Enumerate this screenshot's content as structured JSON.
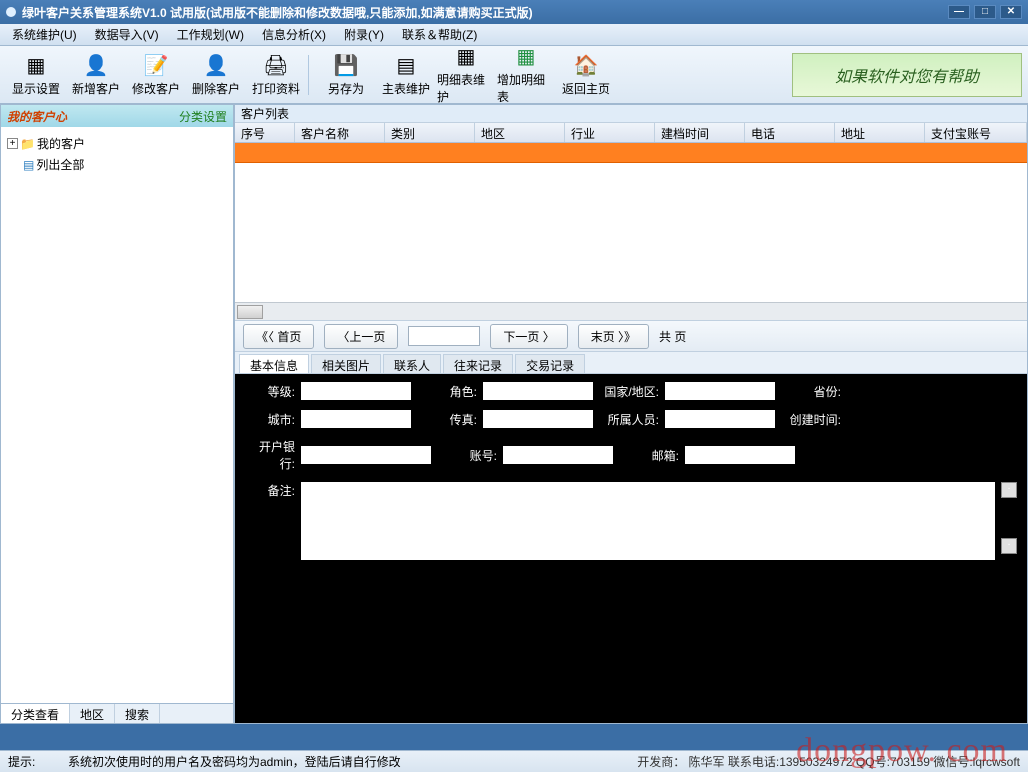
{
  "window": {
    "title": "绿叶客户关系管理系统V1.0 试用版(试用版不能删除和修改数据哦,只能添加,如满意请购买正式版)"
  },
  "menu": [
    "系统维护(U)",
    "数据导入(V)",
    "工作规划(W)",
    "信息分析(X)",
    "附录(Y)",
    "联系＆帮助(Z)"
  ],
  "toolbar": {
    "display": "显示设置",
    "add": "新增客户",
    "edit": "修改客户",
    "del": "删除客户",
    "print": "打印资料",
    "saveas": "另存为",
    "main": "主表维护",
    "detail": "明细表维护",
    "adddetail": "增加明细表",
    "home": "返回主页"
  },
  "banner": "如果软件对您有帮助",
  "sidebar": {
    "header": "我的客户心",
    "settings": "分类设置",
    "nodes": [
      "我的客户",
      "列出全部"
    ],
    "tabs": [
      "分类查看",
      "地区",
      "搜索"
    ]
  },
  "list": {
    "title": "客户列表",
    "cols": [
      "序号",
      "客户名称",
      "类别",
      "地区",
      "行业",
      "建档时间",
      "电话",
      "地址",
      "支付宝账号"
    ]
  },
  "pager": {
    "first": "《〈 首页",
    "prev": "〈上一页",
    "next": "下一页 〉",
    "last": "末页 〉》",
    "total": "共    页"
  },
  "dtabs": [
    "基本信息",
    "相关图片",
    "联系人",
    "往来记录",
    "交易记录"
  ],
  "detail": {
    "level": "等级:",
    "role": "角色:",
    "region": "国家/地区:",
    "prov": "省份:",
    "city": "城市:",
    "fax": "传真:",
    "staff": "所属人员:",
    "ctime": "创建时间:",
    "bank": "开户银行:",
    "acct": "账号:",
    "email": "邮箱:",
    "remark": "备注:"
  },
  "status": {
    "hint": "提示:",
    "msg": "系统初次使用时的用户名及密码均为admin，登陆后请自行修改",
    "dev": "开发商：      陈华军  联系电话:13950324972   QQ号:703159 微信号:lqrcwsoft"
  },
  "watermark": "dongpow. com"
}
